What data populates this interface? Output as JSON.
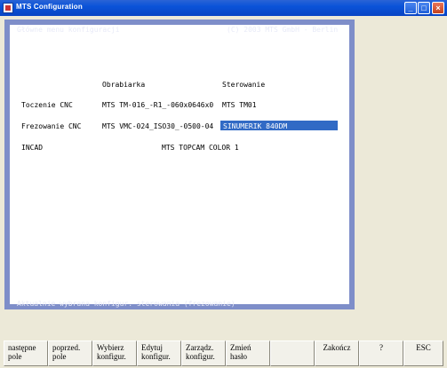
{
  "window": {
    "title": "MTS Configuration",
    "minimize": "_",
    "maximize": "□",
    "close": "×"
  },
  "terminal": {
    "header_left": "Główne menu konfiguracji",
    "header_right": "(C) 2003 MTS GmbH - Berlin",
    "col_headers": [
      "Obrabiarka",
      "Sterowanie"
    ],
    "rows": [
      {
        "label": "Toczenie CNC",
        "machine": "MTS TM-016_-R1_-060x0646x0",
        "control": "MTS TM01",
        "selected": false
      },
      {
        "label": "Frezowanie CNC",
        "machine": "MTS VMC-024_ISO30_-0500-04",
        "control": "SINUMERIK 840DM",
        "selected": true
      },
      {
        "label": "INCAD",
        "machine": "MTS TOPCAM COLOR 1",
        "control": "",
        "selected": false
      }
    ],
    "footer": "Aktualnie wybrana konfigur. sterowania (frezowanie)"
  },
  "function_keys": [
    {
      "line1": "następne",
      "line2": "pole"
    },
    {
      "line1": "poprzed.",
      "line2": "pole"
    },
    {
      "line1": "Wybierz",
      "line2": "konfigur."
    },
    {
      "line1": "Edytuj",
      "line2": "konfigur."
    },
    {
      "line1": "Zarządz.",
      "line2": "konfigur."
    },
    {
      "line1": "Zmień",
      "line2": "hasło"
    },
    {
      "line1": "",
      "line2": ""
    },
    {
      "line1": "Zakończ",
      "line2": ""
    },
    {
      "line1": "?",
      "line2": ""
    },
    {
      "line1": "ESC",
      "line2": ""
    }
  ],
  "colors": {
    "frame": "#7E8EC9",
    "highlight": "#316AC5",
    "titlebar": "#0A53D8"
  }
}
